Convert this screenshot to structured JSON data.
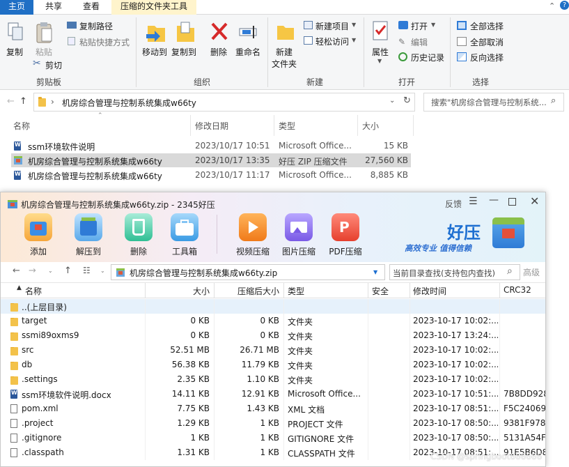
{
  "explorer": {
    "tabs": [
      "主页",
      "共享",
      "查看",
      "压缩的文件夹工具"
    ],
    "ribbon": {
      "copy": "复制",
      "paste": "粘贴",
      "copy_path": "复制路径",
      "paste_shortcut": "粘贴快捷方式",
      "cut": "剪切",
      "clipboard": "剪贴板",
      "move_to": "移动到",
      "copy_to": "复制到",
      "delete": "删除",
      "rename": "重命名",
      "organize": "组织",
      "new_folder_1": "新建",
      "new_folder_2": "文件夹",
      "new_item": "新建项目",
      "easy_access": "轻松访问",
      "new": "新建",
      "properties": "属性",
      "open": "打开",
      "edit": "编辑",
      "history": "历史记录",
      "open_group": "打开",
      "select_all": "全部选择",
      "select_none": "全部取消",
      "invert": "反向选择",
      "select": "选择"
    },
    "path": "机房综合管理与控制系统集成w66ty",
    "search_placeholder": "搜索\"机房综合管理与控制系统...",
    "columns": [
      "名称",
      "修改日期",
      "类型",
      "大小"
    ],
    "files": [
      {
        "name": "ssm环境软件说明",
        "date": "2023/10/17 10:51",
        "type": "Microsoft Office...",
        "size": "15 KB",
        "icon": "word-doc-icon"
      },
      {
        "name": "机房综合管理与控制系统集成w66ty",
        "date": "2023/10/17 13:35",
        "type": "好压 ZIP 压缩文件",
        "size": "27,560 KB",
        "icon": "zip-icon"
      },
      {
        "name": "机房综合管理与控制系统集成w66ty",
        "date": "2023/10/17 11:17",
        "type": "Microsoft Office...",
        "size": "8,885 KB",
        "icon": "word-doc-icon"
      }
    ]
  },
  "zip": {
    "title": "机房综合管理与控制系统集成w66ty.zip - 2345好压",
    "feedback": "反馈",
    "tools": [
      "添加",
      "解压到",
      "删除",
      "工具箱",
      "视频压缩",
      "图片压缩",
      "PDF压缩"
    ],
    "brand": {
      "name": "好压",
      "slogan": "高效专业 值得信赖"
    },
    "path": "机房综合管理与控制系统集成w66ty.zip",
    "search_placeholder": "当前目录查找(支持包内查找)",
    "advanced": "高级",
    "columns": [
      "名称",
      "大小",
      "压缩后大小",
      "类型",
      "安全",
      "修改时间",
      "CRC32"
    ],
    "rows": [
      {
        "name": "..(上层目录)",
        "size": "",
        "packed": "",
        "type": "",
        "time": "",
        "crc": "",
        "icon": "folder"
      },
      {
        "name": "target",
        "size": "0 KB",
        "packed": "0 KB",
        "type": "文件夹",
        "time": "2023-10-17 10:02:...",
        "crc": "",
        "icon": "folder"
      },
      {
        "name": "ssmi89oxms9",
        "size": "0 KB",
        "packed": "0 KB",
        "type": "文件夹",
        "time": "2023-10-17 13:24:...",
        "crc": "",
        "icon": "folder"
      },
      {
        "name": "src",
        "size": "52.51 MB",
        "packed": "26.71 MB",
        "type": "文件夹",
        "time": "2023-10-17 10:02:...",
        "crc": "",
        "icon": "folder"
      },
      {
        "name": "db",
        "size": "56.38 KB",
        "packed": "11.79 KB",
        "type": "文件夹",
        "time": "2023-10-17 10:02:...",
        "crc": "",
        "icon": "folder"
      },
      {
        "name": ".settings",
        "size": "2.35 KB",
        "packed": "1.10 KB",
        "type": "文件夹",
        "time": "2023-10-17 10:02:...",
        "crc": "",
        "icon": "folder"
      },
      {
        "name": "ssm环境软件说明.docx",
        "size": "14.11 KB",
        "packed": "12.91 KB",
        "type": "Microsoft Office...",
        "time": "2023-10-17 10:51:...",
        "crc": "7B8DD928",
        "icon": "word"
      },
      {
        "name": "pom.xml",
        "size": "7.75 KB",
        "packed": "1.43 KB",
        "type": "XML 文档",
        "time": "2023-10-17 08:51:...",
        "crc": "F5C24069",
        "icon": "doc"
      },
      {
        "name": ".project",
        "size": "1.29 KB",
        "packed": "1 KB",
        "type": "PROJECT 文件",
        "time": "2023-10-17 08:50:...",
        "crc": "9381F978",
        "icon": "doc"
      },
      {
        "name": ".gitignore",
        "size": "1 KB",
        "packed": "1 KB",
        "type": "GITIGNORE 文件",
        "time": "2023-10-17 08:50:...",
        "crc": "5131A54F",
        "icon": "doc"
      },
      {
        "name": ".classpath",
        "size": "1.31 KB",
        "packed": "1 KB",
        "type": "CLASSPATH 文件",
        "time": "2023-10-17 08:51:...",
        "crc": "91E5B6D8",
        "icon": "doc"
      }
    ]
  },
  "watermark": "CSDN @springboot666666"
}
